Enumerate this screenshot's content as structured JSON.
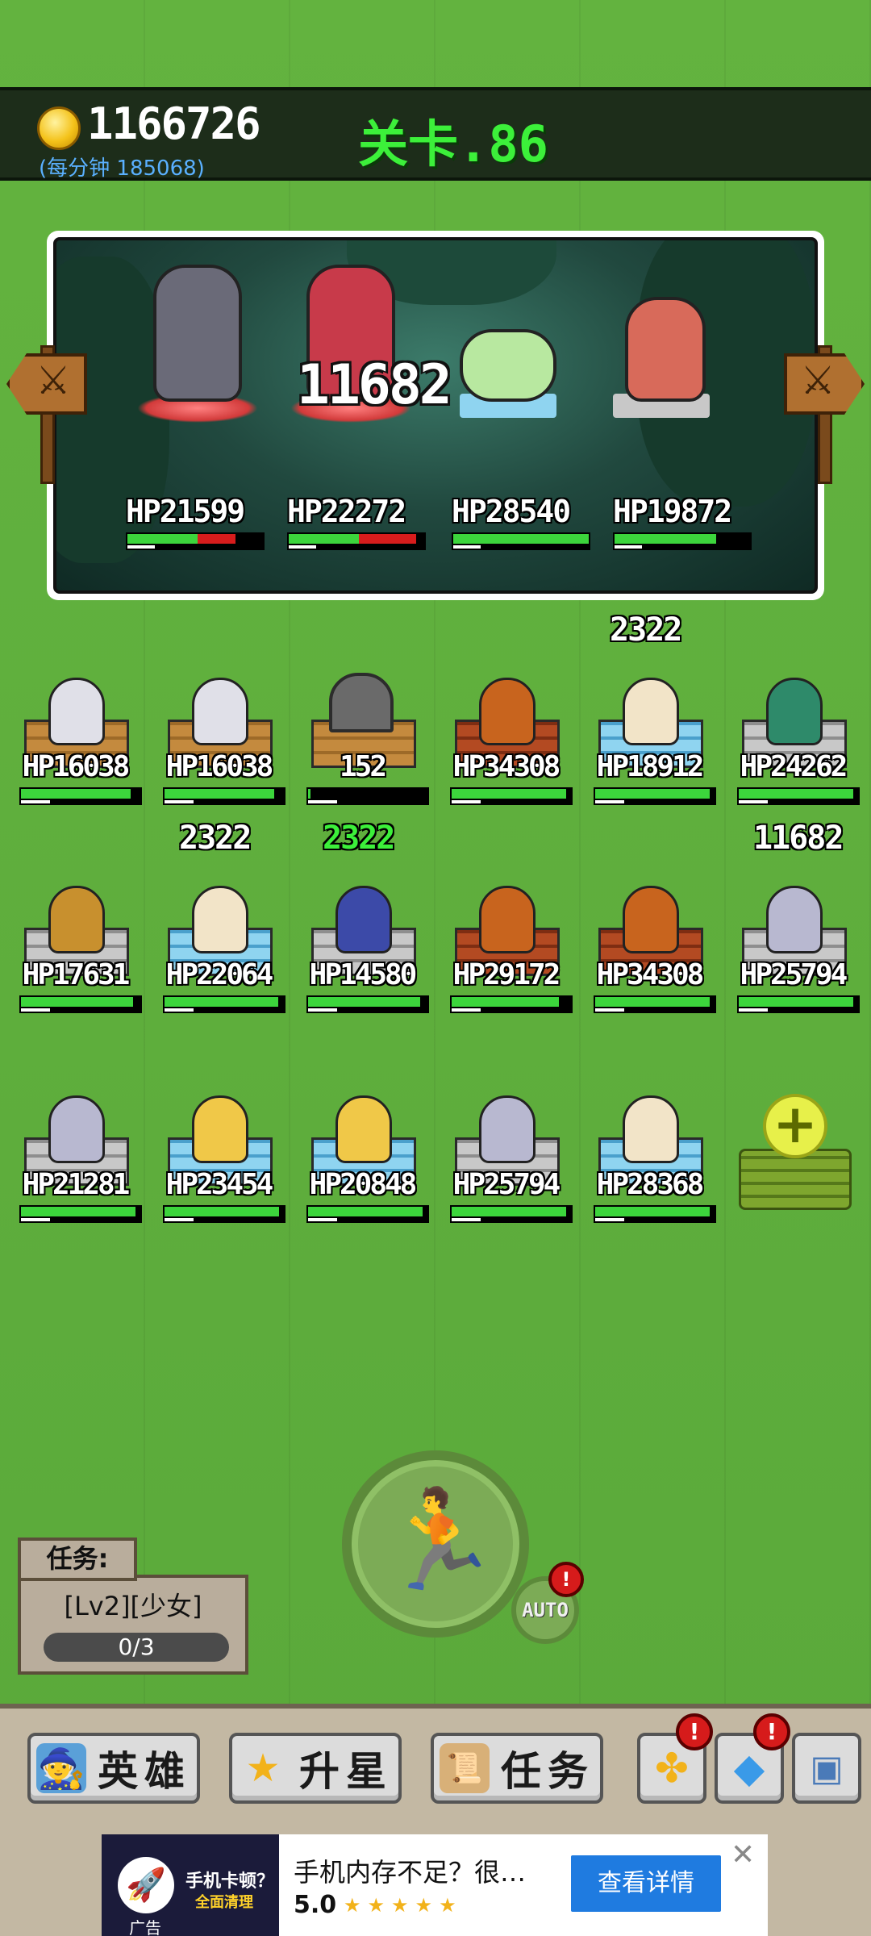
{
  "header": {
    "gold": "1166726",
    "per_minute": "(每分钟 185068)",
    "stage": "关卡.86"
  },
  "battle": {
    "damage_text": "11682",
    "enemies": [
      {
        "hp": "HP21599",
        "hp_fraction": 0.52,
        "lost_fraction": 0.28
      },
      {
        "hp": "HP22272",
        "hp_fraction": 0.52,
        "lost_fraction": 0.42
      },
      {
        "hp": "HP28540",
        "hp_fraction": 1.0,
        "lost_fraction": 0
      },
      {
        "hp": "HP19872",
        "hp_fraction": 0.75,
        "lost_fraction": 0
      }
    ]
  },
  "heroes": {
    "row1": [
      {
        "hp": "HP16038",
        "fill": 0.92,
        "base": "wood",
        "sprite_color": "#e0e0e8"
      },
      {
        "hp": "HP16038",
        "fill": 0.92,
        "base": "wood",
        "sprite_color": "#e0e0e8"
      },
      {
        "hp": "152",
        "fill": 0.02,
        "base": "wood",
        "tomb": true
      },
      {
        "hp": "HP34308",
        "fill": 0.96,
        "base": "redwood",
        "sprite_color": "#c8641e"
      },
      {
        "hp": "HP18912",
        "fill": 0.96,
        "base": "ice",
        "sprite_color": "#f2e4c8",
        "float": "2322"
      },
      {
        "hp": "HP24262",
        "fill": 0.96,
        "base": "stone",
        "sprite_color": "#2e8a6a"
      }
    ],
    "row2": [
      {
        "hp": "HP17631",
        "fill": 0.94,
        "base": "stone",
        "sprite_color": "#c8902e"
      },
      {
        "hp": "HP22064",
        "fill": 0.95,
        "base": "ice",
        "sprite_color": "#f2e4c8",
        "float": "2322"
      },
      {
        "hp": "HP14580",
        "fill": 0.94,
        "base": "stone",
        "sprite_color": "#3c4aa8",
        "float": "2322",
        "float_green": true
      },
      {
        "hp": "HP29172",
        "fill": 0.9,
        "base": "redwood",
        "sprite_color": "#c8641e"
      },
      {
        "hp": "HP34308",
        "fill": 0.96,
        "base": "redwood",
        "sprite_color": "#c8641e"
      },
      {
        "hp": "HP25794",
        "fill": 0.96,
        "base": "stone",
        "sprite_color": "#b8b8d0",
        "float": "11682"
      }
    ],
    "row3": [
      {
        "hp": "HP21281",
        "fill": 0.96,
        "base": "stone",
        "sprite_color": "#b8b8d0"
      },
      {
        "hp": "HP23454",
        "fill": 0.96,
        "base": "ice",
        "sprite_color": "#f0c848"
      },
      {
        "hp": "HP20848",
        "fill": 0.96,
        "base": "ice",
        "sprite_color": "#f0c848"
      },
      {
        "hp": "HP25794",
        "fill": 0.96,
        "base": "stone",
        "sprite_color": "#b8b8d0"
      },
      {
        "hp": "HP28368",
        "fill": 0.96,
        "base": "ice",
        "sprite_color": "#f2e4c8"
      }
    ]
  },
  "controls": {
    "auto_label": "AUTO",
    "alert_badge": "!"
  },
  "task": {
    "label": "任务:",
    "name": "[Lv2][少女]",
    "progress": "0/3"
  },
  "menu": {
    "heroes": "英雄",
    "star_up": "升星",
    "tasks": "任务"
  },
  "ad": {
    "promo_title": "手机卡顿？",
    "promo_sub": "全面清理",
    "tag": "广告",
    "text": "手机内存不足？很…",
    "rating": "5.0",
    "stars": "★★★★★",
    "cta": "查看详情",
    "close": "✕"
  }
}
